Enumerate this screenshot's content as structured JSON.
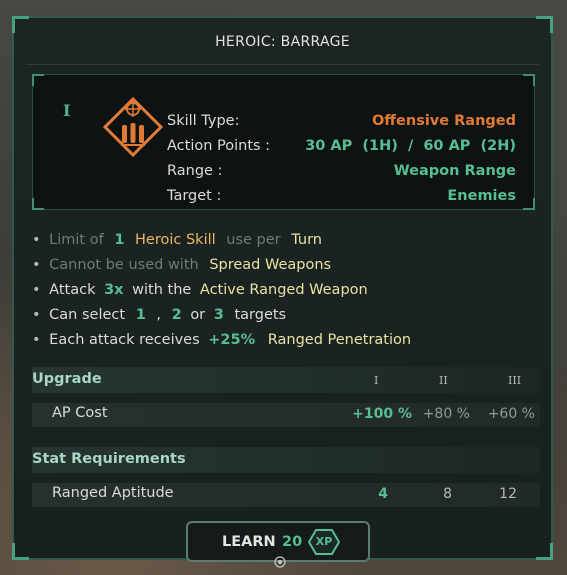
{
  "title": "HEROIC: BARRAGE",
  "tier": "I",
  "skill": {
    "rows": [
      {
        "label": "Skill Type:",
        "value": "Offensive Ranged"
      },
      {
        "label": "Action Points :",
        "value": "30 AP  (1H)  /  60 AP  (2H)"
      },
      {
        "label": "Range :",
        "value": "Weapon Range"
      },
      {
        "label": "Target :",
        "value": "Enemies"
      }
    ]
  },
  "bullets": {
    "b1": {
      "p1": "Limit of",
      "n": "1",
      "p2": "Heroic Skill",
      "p3": "use per",
      "p4": "Turn"
    },
    "b2": {
      "p1": "Cannot be used with",
      "p2": "Spread Weapons"
    },
    "b3": {
      "p1": "Attack",
      "n": "3x",
      "p2": "with the",
      "p3": "Active Ranged Weapon"
    },
    "b4": {
      "p1": "Can select",
      "n1": "1",
      "sep1": ",",
      "n2": "2",
      "sep2": "or",
      "n3": "3",
      "p2": "targets"
    },
    "b5": {
      "p1": "Each attack receives",
      "n": "+25%",
      "p2": "Ranged Penetration"
    }
  },
  "upgrade": {
    "heading": "Upgrade",
    "levels": [
      "I",
      "II",
      "III"
    ],
    "row_label": "AP Cost",
    "values": [
      "+100 %",
      "+80 %",
      "+60 %"
    ]
  },
  "requirements": {
    "heading": "Stat Requirements",
    "row_label": "Ranged Aptitude",
    "values": [
      "4",
      "8",
      "12"
    ]
  },
  "learn": {
    "label": "LEARN",
    "cost": "20",
    "currency": "XP"
  },
  "colors": {
    "accent": "#56bf91",
    "orange": "#e07a35",
    "gold": "#e9b660",
    "frame": "#2f5a4c"
  }
}
